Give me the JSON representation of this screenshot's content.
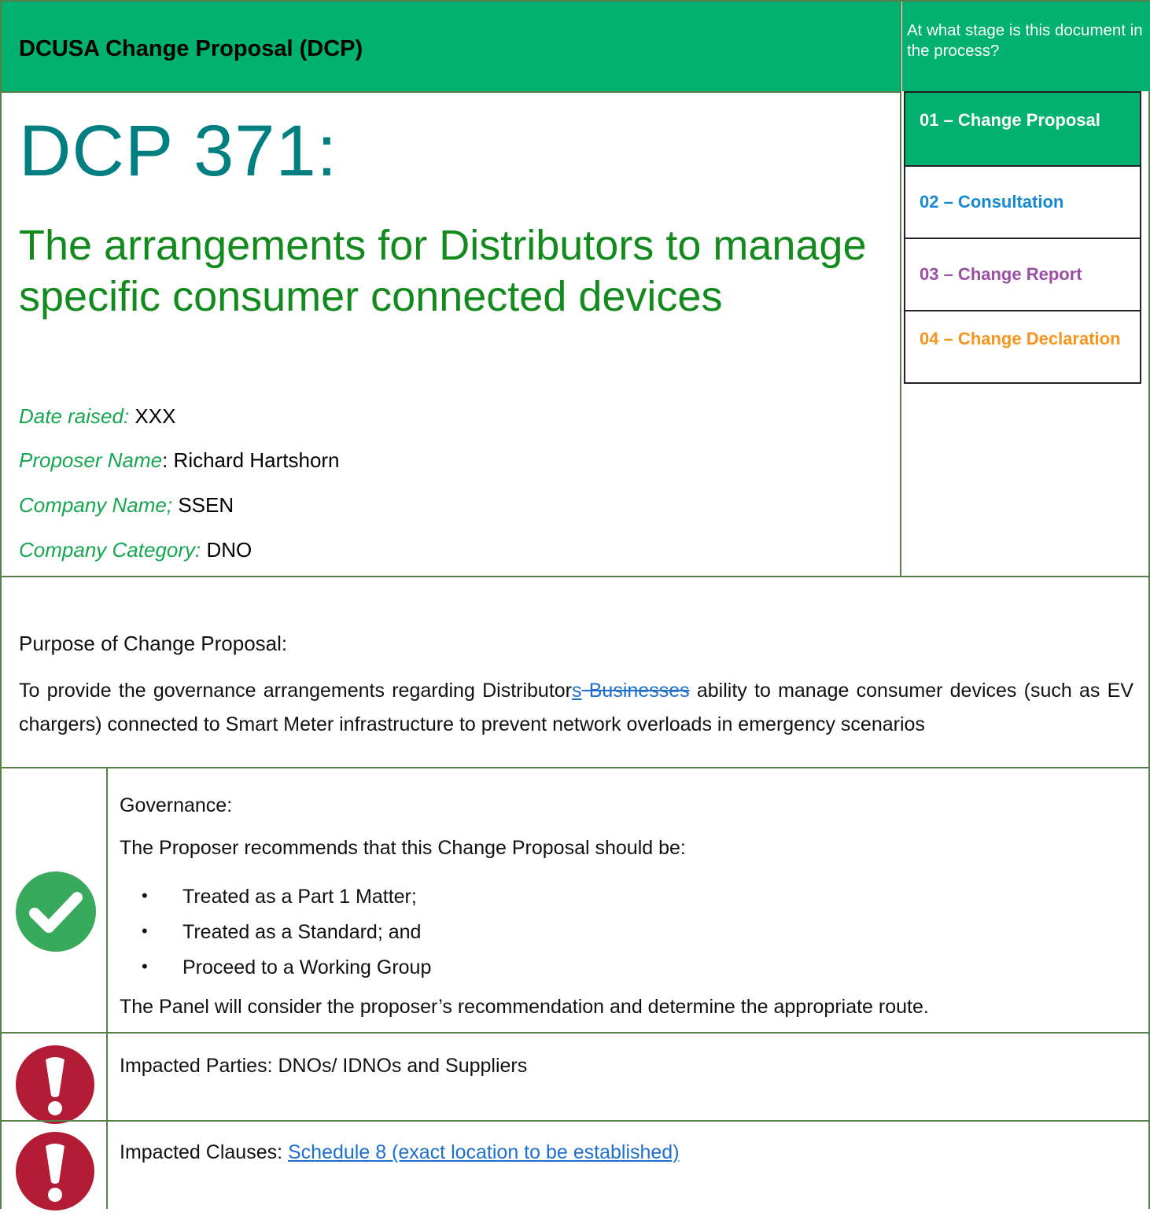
{
  "header": {
    "title": "DCUSA Change Proposal (DCP)",
    "stage_question": "At what stage is this document in the process?"
  },
  "stages": [
    {
      "label": "01 – Change Proposal",
      "color": "#00b16f",
      "active": true
    },
    {
      "label": "02 – Consultation",
      "color": "#1689d2",
      "active": false
    },
    {
      "label": "03 – Change Report",
      "color": "#9b4ea3",
      "active": false
    },
    {
      "label": "04 – Change Declaration",
      "color": "#f7941d",
      "active": false
    }
  ],
  "dcp": {
    "number": "DCP 371:",
    "title": "The arrangements for Distributors to manage specific consumer connected devices"
  },
  "meta": {
    "date_label": "Date raised:",
    "date_value": "XXX",
    "proposer_label": "Proposer Name",
    "proposer_sep": ":",
    "proposer_value": "Richard Hartshorn",
    "company_label": "Company Name;",
    "company_value": "SSEN",
    "category_label": "Company Category:",
    "category_value": "DNO"
  },
  "purpose": {
    "heading": "Purpose of Change Proposal:",
    "text_before": "To provide the governance arrangements regarding Distributor",
    "text_inserted": "s",
    "text_deleted": " Businesses",
    "text_after": " ability to manage consumer devices (such as EV chargers) connected to Smart Meter infrastructure to prevent network overloads in emergency scenarios"
  },
  "governance": {
    "icon": "check-circle-icon",
    "heading": "Governance:",
    "intro": "The Proposer recommends that this Change Proposal should be:",
    "items": [
      "Treated as a Part 1 Matter;",
      "Treated as a Standard; and",
      "Proceed to a Working Group"
    ],
    "note": "The Panel will consider the proposer’s recommendation and determine the appropriate route."
  },
  "impacted_parties": {
    "icon": "exclamation-circle-icon",
    "text": "Impacted Parties: DNOs/ IDNOs and Suppliers"
  },
  "impacted_clauses": {
    "icon": "exclamation-circle-icon",
    "label": "Impacted Clauses: ",
    "link_text": "Schedule 8 (exact location to be established)"
  }
}
